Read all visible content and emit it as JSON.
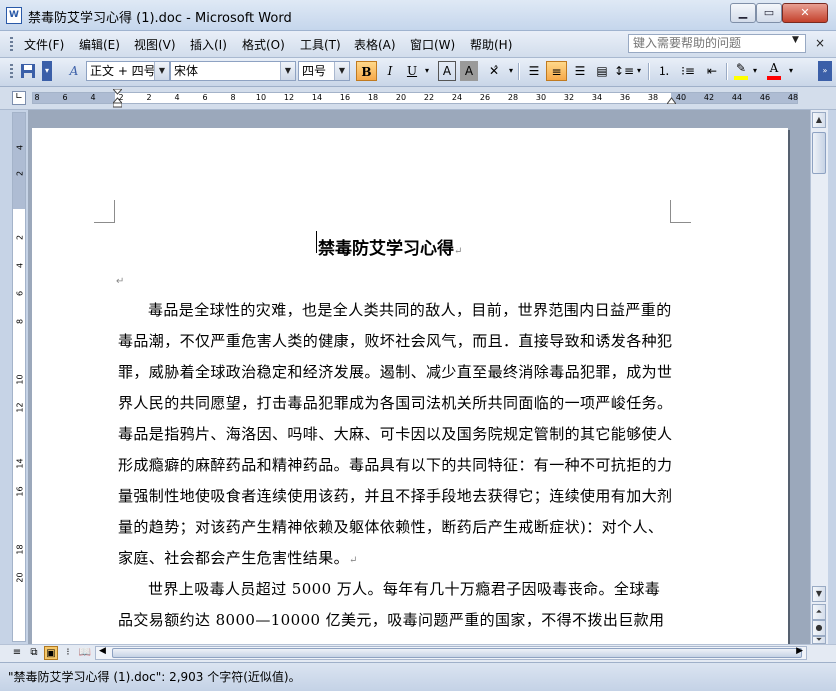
{
  "window": {
    "title": "禁毒防艾学习心得 (1).doc - Microsoft Word",
    "app_icon": "word-doc-icon",
    "controls": {
      "minimize": "minimize-icon",
      "maximize": "maximize-icon",
      "close": "close-icon"
    }
  },
  "menubar": {
    "items": [
      "文件(F)",
      "编辑(E)",
      "视图(V)",
      "插入(I)",
      "格式(O)",
      "工具(T)",
      "表格(A)",
      "窗口(W)",
      "帮助(H)"
    ],
    "help_placeholder": "键入需要帮助的问题"
  },
  "toolbar": {
    "style_value": "正文 + 四号",
    "font_value": "宋体",
    "size_value": "四号",
    "bold_label": "B",
    "italic_label": "I",
    "underline_label": "U",
    "font_color_label": "A",
    "center_align_active": true,
    "highlight_color": "#ffff00",
    "font_color": "#ff0000"
  },
  "ruler": {
    "numbers": [
      "8",
      "6",
      "4",
      "2",
      "2",
      "4",
      "6",
      "8",
      "10",
      "12",
      "14",
      "16",
      "18",
      "20",
      "22",
      "24",
      "26",
      "28",
      "30",
      "32",
      "34",
      "36",
      "38",
      "40",
      "42",
      "44",
      "46",
      "48"
    ],
    "vertical_numbers": [
      "4",
      "2",
      "2",
      "4",
      "6",
      "8",
      "10",
      "12",
      "14",
      "16",
      "18",
      "20"
    ]
  },
  "document": {
    "title": "禁毒防艾学习心得",
    "paragraph_mark": "↵",
    "paragraphs": [
      "毒品是全球性的灾难，也是全人类共同的敌人，目前，世界范围内日益严重的毒品潮，不仅严重危害人类的健康，败坏社会风气，而且．直接导致和诱发各种犯罪，威胁着全球政治稳定和经济发展。遏制、减少直至最终消除毒品犯罪，成为世界人民的共同愿望，打击毒品犯罪成为各国司法机关所共同面临的一项严峻任务。毒品是指鸦片、海洛因、吗啡、大麻、可卡因以及国务院规定管制的其它能够使人形成瘾癖的麻醉药品和精神药品。毒品具有以下的共同特征：有一种不可抗拒的力量强制性地使吸食者连续使用该药，并且不择手段地去获得它；连续使用有加大剂量的趋势；对该药产生精神依赖及躯体依赖性，断药后产生戒断症状)：对个人、家庭、社会都会产生危害性结果。",
      "世界上吸毒人员超过 5000 万人。每年有几十万瘾君子因吸毒丧命。全球毒品交易额约达 8000—10000 亿美元，吸毒问题严重的国家，不得不拨出巨款用于"
    ]
  },
  "statusbar": {
    "text": "\"禁毒防艾学习心得 (1).doc\": 2,903 个字符(近似值)。"
  }
}
